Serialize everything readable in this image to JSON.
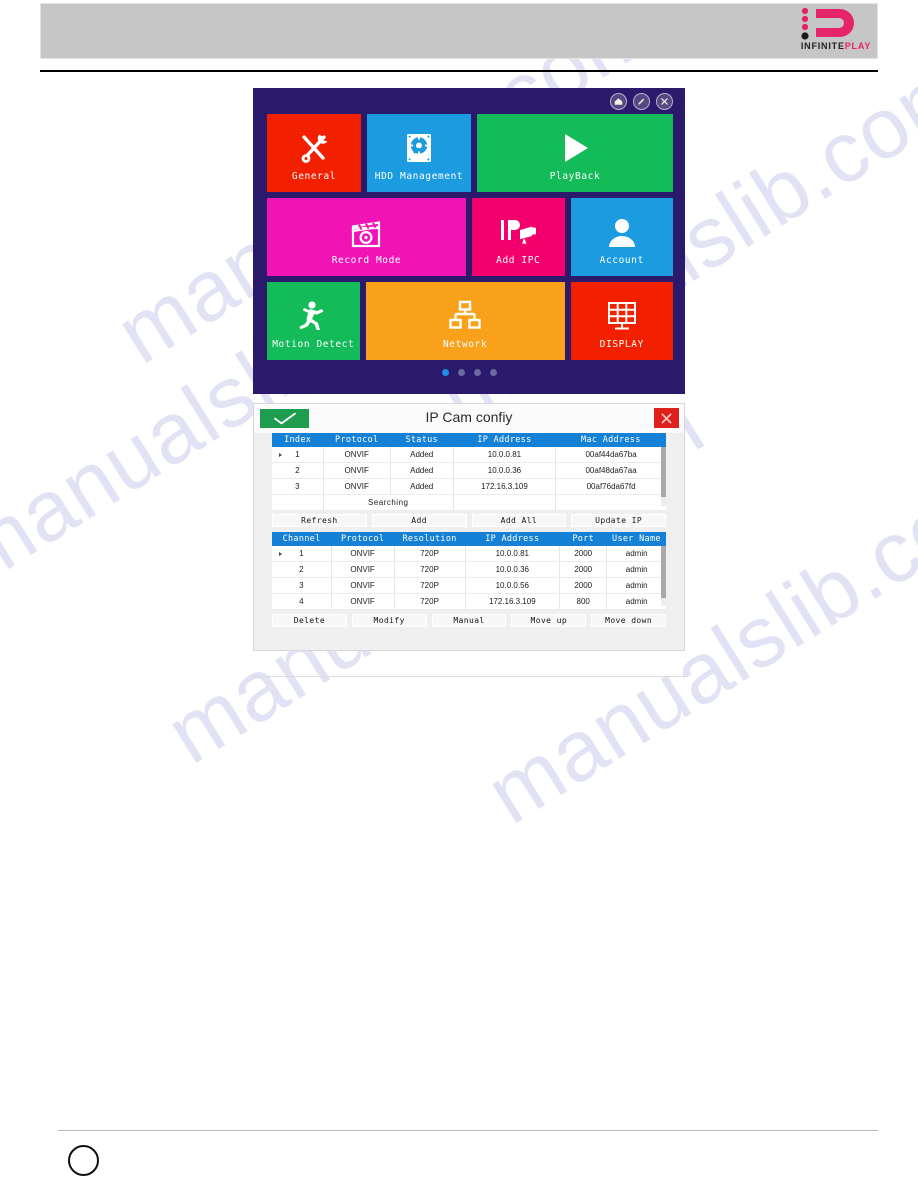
{
  "document": {
    "brand": {
      "logo_icon": "infiniteplay-logo-icon",
      "word_dark": "INFINITE",
      "word_pink": "PLAY",
      "pink": "#e6246a",
      "dark": "#231f20"
    },
    "watermark_text": "manualslib.com",
    "page_number": ""
  },
  "nvr_menu": {
    "window_buttons": [
      {
        "name": "home-icon",
        "glyph": "⌂"
      },
      {
        "name": "edit-pencil-icon",
        "glyph": "✎"
      },
      {
        "name": "close-icon",
        "glyph": "✕"
      }
    ],
    "tiles": [
      {
        "label": "General",
        "icon": "tools-icon",
        "color": "#f32000"
      },
      {
        "label": "HDD Management",
        "icon": "hard-disk-icon",
        "color": "#1b9be0"
      },
      {
        "label": "PlayBack",
        "icon": "play-icon",
        "color": "#13bb59"
      },
      {
        "label": "Record Mode",
        "icon": "clapperboard-icon",
        "color": "#f213b7"
      },
      {
        "label": "Add IPC",
        "icon": "ip-camera-icon",
        "color": "#f4006e"
      },
      {
        "label": "Account",
        "icon": "user-icon",
        "color": "#1b9be0"
      },
      {
        "label": "Motion Detect",
        "icon": "running-man-icon",
        "color": "#13bb59"
      },
      {
        "label": "Network",
        "icon": "network-icon",
        "color": "#f9a11b"
      },
      {
        "label": "DISPLAY",
        "icon": "grid-monitor-icon",
        "color": "#f32000"
      }
    ],
    "pagination": {
      "total": 4,
      "active_index": 0
    },
    "background": "#2b1a6b"
  },
  "dialog": {
    "title": "IP Cam confiy",
    "ok_icon": "checkmark-icon",
    "close_icon": "close-x-icon",
    "ok_color": "#1f9d4e",
    "close_color": "#e0211b",
    "header_color": "#1481d6",
    "search_table": {
      "columns": [
        "Index",
        "Protocol",
        "Status",
        "IP Address",
        "Mac Address"
      ],
      "rows": [
        {
          "index": "1",
          "protocol": "ONVIF",
          "status": "Added",
          "ip": "10.0.0.81",
          "mac": "00af44da67ba",
          "selected": true
        },
        {
          "index": "2",
          "protocol": "ONVIF",
          "status": "Added",
          "ip": "10.0.0.36",
          "mac": "00af48da67aa",
          "selected": false
        },
        {
          "index": "3",
          "protocol": "ONVIF",
          "status": "Added",
          "ip": "172.16.3.109",
          "mac": "00af76da67fd",
          "selected": false
        }
      ],
      "status_row": "Searching"
    },
    "search_buttons": [
      "Refresh",
      "Add",
      "Add All",
      "Update IP"
    ],
    "channel_table": {
      "columns": [
        "Channel",
        "Protocol",
        "Resolution",
        "IP Address",
        "Port",
        "User Name"
      ],
      "rows": [
        {
          "channel": "1",
          "protocol": "ONVIF",
          "resolution": "720P",
          "ip": "10.0.0.81",
          "port": "2000",
          "user": "admin",
          "selected": true
        },
        {
          "channel": "2",
          "protocol": "ONVIF",
          "resolution": "720P",
          "ip": "10.0.0.36",
          "port": "2000",
          "user": "admin",
          "selected": false
        },
        {
          "channel": "3",
          "protocol": "ONVIF",
          "resolution": "720P",
          "ip": "10.0.0.56",
          "port": "2000",
          "user": "admin",
          "selected": false
        },
        {
          "channel": "4",
          "protocol": "ONVIF",
          "resolution": "720P",
          "ip": "172.16.3.109",
          "port": "800",
          "user": "admin",
          "selected": false
        }
      ]
    },
    "channel_buttons": [
      "Delete",
      "Modify",
      "Manual",
      "Move up",
      "Move down"
    ]
  }
}
